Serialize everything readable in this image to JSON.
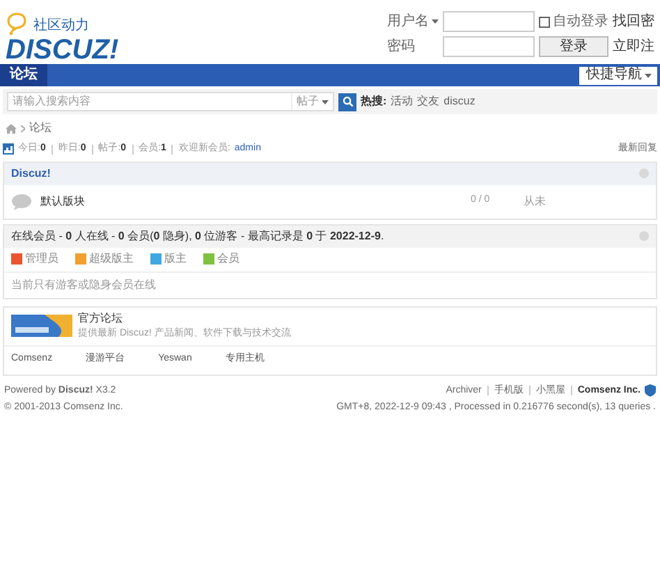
{
  "logo": {
    "slogan": "社区动力",
    "wordmark": "DISCUZ!"
  },
  "login": {
    "username_label": "用户名",
    "password_label": "密码",
    "remember": {
      "label": "自动登录",
      "checked": false
    },
    "login_button": "登录",
    "forgot_link": "找回密",
    "register_link": "立即注"
  },
  "nav": {
    "items": [
      {
        "label": "论坛",
        "selected": true
      }
    ],
    "quick_nav": "快捷导航"
  },
  "search": {
    "placeholder": "请输入搜索内容",
    "type": "帖子",
    "hot_label": "热搜:",
    "hot_terms": [
      "活动",
      "交友",
      "discuz"
    ]
  },
  "breadcrumb": [
    "论坛"
  ],
  "stats": [
    {
      "label": "今日:",
      "value": "0"
    },
    {
      "label": "昨日:",
      "value": "0"
    },
    {
      "label": "帖子:",
      "value": "0"
    },
    {
      "label": "会员:",
      "value": "1"
    }
  ],
  "welcome": {
    "label": "欢迎新会员:",
    "user": "admin"
  },
  "latest_link": "最新回复",
  "category": {
    "title": "Discuz!",
    "forums": [
      {
        "name": "默认版块",
        "counts": "0 / 0",
        "last": "从未"
      }
    ]
  },
  "online": {
    "title": "在线会员 - **0** 人在线 - **0** 会员(**0** 隐身), **0** 位游客 - 最高记录是 **0** 于 **2022-12-9**.",
    "legend": [
      {
        "label": "管理员",
        "color": "#e8552f"
      },
      {
        "label": "超级版主",
        "color": "#f0a030"
      },
      {
        "label": "版主",
        "color": "#40a8e0"
      },
      {
        "label": "会员",
        "color": "#80c040"
      }
    ],
    "note": "当前只有游客或隐身会员在线"
  },
  "links": {
    "featured": {
      "title": "官方论坛",
      "description": "提供最新 Discuz! 产品新闻、软件下载与技术交流"
    },
    "text_links": [
      "Comsenz",
      "漫游平台",
      "Yeswan",
      "专用主机"
    ]
  },
  "footer": {
    "powered": "Powered by **Discuz!** X3.2",
    "copyright": "© 2001-2013 Comsenz Inc.",
    "links": [
      "Archiver",
      "手机版",
      "小黑屋"
    ],
    "company": "Comsenz Inc.",
    "timing": "GMT+8, 2022-12-9 09:43 , Processed in 0.216776 second(s), 13 queries ."
  }
}
